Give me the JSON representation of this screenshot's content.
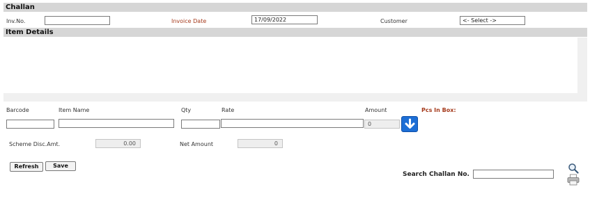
{
  "challan_header": {
    "title": "Challan"
  },
  "header_fields": {
    "inv_no_label": "Inv.No.",
    "inv_no_value": "",
    "invoice_date_label": "Invoice Date",
    "invoice_date_value": "17/09/2022",
    "customer_label": "Customer",
    "customer_selected": "<- Select ->"
  },
  "item_details": {
    "title": "Item Details"
  },
  "item_entry": {
    "barcode_label": "Barcode",
    "item_name_label": "Item Name",
    "qty_label": "Qty",
    "rate_label": "Rate",
    "amount_label": "Amount",
    "amount_value": "0",
    "pcs_in_box_label": "Pcs In Box:",
    "add_icon": "arrow-down-icon"
  },
  "totals": {
    "scheme_disc_label": "Scheme Disc.Amt.",
    "scheme_disc_value": "0.00",
    "net_amount_label": "Net Amount",
    "net_amount_value": "0"
  },
  "actions": {
    "refresh_label": "Refresh",
    "save_label": "Save"
  },
  "search": {
    "label": "Search Challan No.",
    "value": "",
    "search_icon": "magnifier-icon",
    "print_icon": "printer-icon"
  },
  "colors": {
    "section_bar": "#d6d6d6",
    "accent_red": "#a53a1c",
    "add_button": "#1d6fd6"
  }
}
